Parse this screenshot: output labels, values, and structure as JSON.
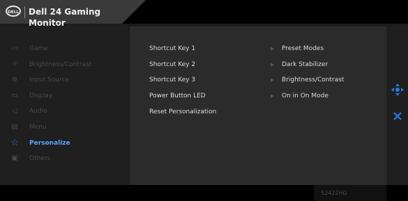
{
  "header": {
    "logo_text": "DELL",
    "title": "Dell 24 Gaming Monitor"
  },
  "menu": [
    {
      "label": "Game",
      "icon": "game-icon"
    },
    {
      "label": "Brightness/Contrast",
      "icon": "brightness-icon"
    },
    {
      "label": "Input Source",
      "icon": "input-source-icon"
    },
    {
      "label": "Display",
      "icon": "display-icon"
    },
    {
      "label": "Audio",
      "icon": "audio-icon"
    },
    {
      "label": "Menu",
      "icon": "menu-icon"
    },
    {
      "label": "Personalize",
      "icon": "star-icon",
      "active": true
    },
    {
      "label": "Others",
      "icon": "others-icon"
    }
  ],
  "settings": [
    {
      "label": "Shortcut Key 1",
      "value": "Preset Modes"
    },
    {
      "label": "Shortcut Key 2",
      "value": "Dark Stabilizer"
    },
    {
      "label": "Shortcut Key 3",
      "value": "Brightness/Contrast"
    },
    {
      "label": "Power Button LED",
      "value": "On in On Mode"
    },
    {
      "label": "Reset Personalization",
      "value": ""
    }
  ],
  "footer": {
    "model": "S2422HG"
  },
  "colors": {
    "accent": "#2b78e4",
    "active_text": "#5ba6ff"
  }
}
